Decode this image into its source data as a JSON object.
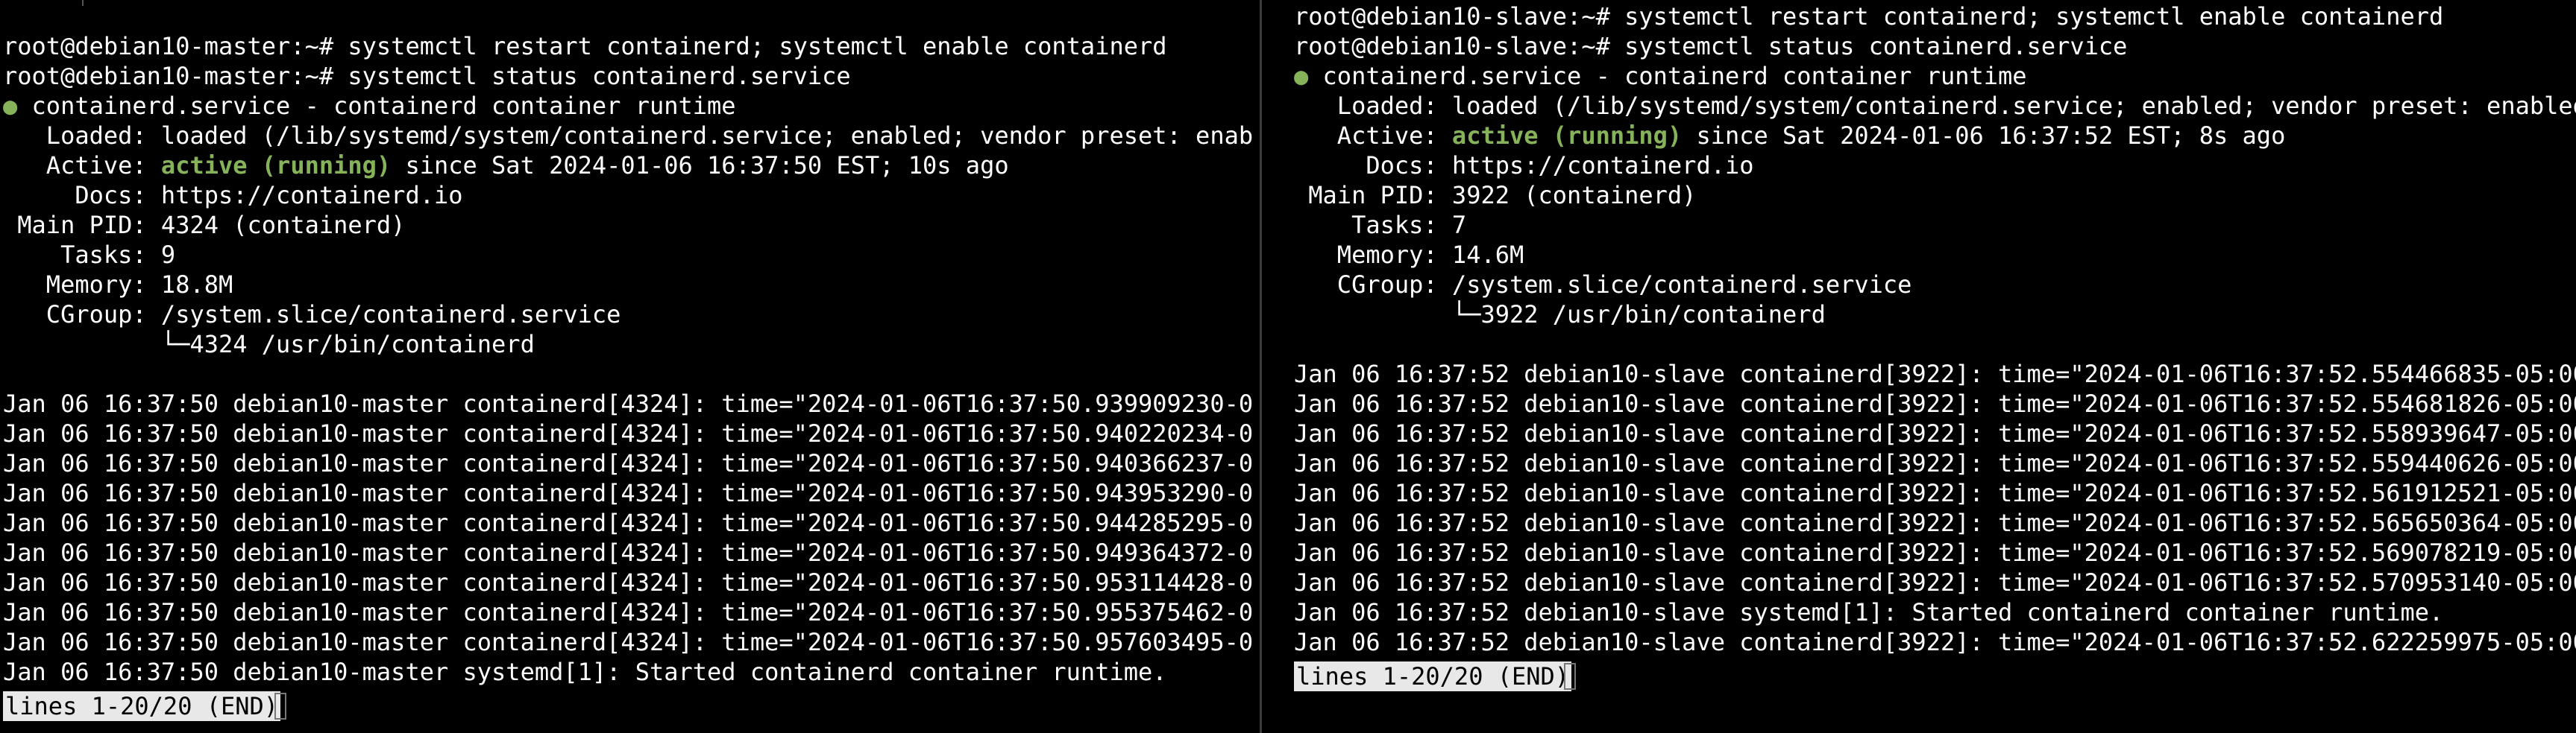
{
  "left": {
    "lines": [
      "root@debian10-master:~# systemctl restart containerd; systemctl enable containerd",
      "root@debian10-master:~# systemctl status containerd.service",
      " containerd.service - containerd container runtime",
      "   Loaded: loaded (/lib/systemd/system/containerd.service; enabled; vendor preset: enab",
      "   Active: ",
      "     Docs: https://containerd.io",
      " Main PID: 4324 (containerd)",
      "    Tasks: 9",
      "   Memory: 18.8M",
      "   CGroup: /system.slice/containerd.service",
      "           └─4324 /usr/bin/containerd",
      "",
      "Jan 06 16:37:50 debian10-master containerd[4324]: time=\"2024-01-06T16:37:50.939909230-0",
      "Jan 06 16:37:50 debian10-master containerd[4324]: time=\"2024-01-06T16:37:50.940220234-0",
      "Jan 06 16:37:50 debian10-master containerd[4324]: time=\"2024-01-06T16:37:50.940366237-0",
      "Jan 06 16:37:50 debian10-master containerd[4324]: time=\"2024-01-06T16:37:50.943953290-0",
      "Jan 06 16:37:50 debian10-master containerd[4324]: time=\"2024-01-06T16:37:50.944285295-0",
      "Jan 06 16:37:50 debian10-master containerd[4324]: time=\"2024-01-06T16:37:50.949364372-0",
      "Jan 06 16:37:50 debian10-master containerd[4324]: time=\"2024-01-06T16:37:50.953114428-0",
      "Jan 06 16:37:50 debian10-master containerd[4324]: time=\"2024-01-06T16:37:50.955375462-0",
      "Jan 06 16:37:50 debian10-master containerd[4324]: time=\"2024-01-06T16:37:50.957603495-0",
      "Jan 06 16:37:50 debian10-master systemd[1]: Started containerd container runtime."
    ],
    "active_state": "active (running)",
    "active_rest": " since Sat 2024-01-06 16:37:50 EST; 10s ago",
    "status_dot": "●",
    "pager": "lines 1-20/20 (END)"
  },
  "right": {
    "lines": [
      "root@debian10-slave:~# systemctl restart containerd; systemctl enable containerd",
      "root@debian10-slave:~# systemctl status containerd.service",
      " containerd.service - containerd container runtime",
      "   Loaded: loaded (/lib/systemd/system/containerd.service; enabled; vendor preset: enabled",
      "   Active: ",
      "     Docs: https://containerd.io",
      " Main PID: 3922 (containerd)",
      "    Tasks: 7",
      "   Memory: 14.6M",
      "   CGroup: /system.slice/containerd.service",
      "           └─3922 /usr/bin/containerd",
      "",
      "Jan 06 16:37:52 debian10-slave containerd[3922]: time=\"2024-01-06T16:37:52.554466835-05:00",
      "Jan 06 16:37:52 debian10-slave containerd[3922]: time=\"2024-01-06T16:37:52.554681826-05:00",
      "Jan 06 16:37:52 debian10-slave containerd[3922]: time=\"2024-01-06T16:37:52.558939647-05:00",
      "Jan 06 16:37:52 debian10-slave containerd[3922]: time=\"2024-01-06T16:37:52.559440626-05:00",
      "Jan 06 16:37:52 debian10-slave containerd[3922]: time=\"2024-01-06T16:37:52.561912521-05:00",
      "Jan 06 16:37:52 debian10-slave containerd[3922]: time=\"2024-01-06T16:37:52.565650364-05:00",
      "Jan 06 16:37:52 debian10-slave containerd[3922]: time=\"2024-01-06T16:37:52.569078219-05:00",
      "Jan 06 16:37:52 debian10-slave containerd[3922]: time=\"2024-01-06T16:37:52.570953140-05:00",
      "Jan 06 16:37:52 debian10-slave systemd[1]: Started containerd container runtime.",
      "Jan 06 16:37:52 debian10-slave containerd[3922]: time=\"2024-01-06T16:37:52.622259975-05:00"
    ],
    "active_state": "active (running)",
    "active_rest": " since Sat 2024-01-06 16:37:52 EST; 8s ago",
    "status_dot": "●",
    "pager": "lines 1-20/20 (END)"
  },
  "colors": {
    "background": "#000000",
    "text": "#ffffff",
    "active_green": "#86b35a",
    "pager_bg": "#e8e8e8"
  }
}
